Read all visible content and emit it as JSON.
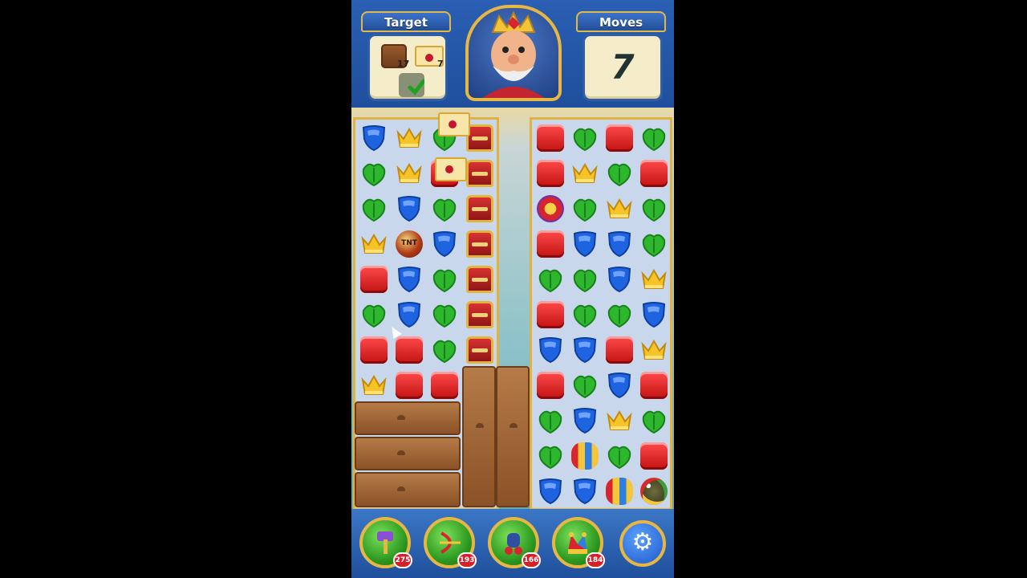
{
  "hud": {
    "target_label": "Target",
    "moves_label": "Moves",
    "moves_value": "7",
    "goals": [
      {
        "name": "crate",
        "count": "17"
      },
      {
        "name": "mail",
        "count": "7"
      },
      {
        "name": "tile",
        "count": "",
        "done": true
      }
    ]
  },
  "board_left": [
    [
      "shield",
      "crown",
      "leaf",
      "chest"
    ],
    [
      "leaf",
      "crown",
      "box",
      "chest"
    ],
    [
      "leaf",
      "shield",
      "leaf",
      "chest"
    ],
    [
      "crown",
      "tnt",
      "shield",
      "chest"
    ],
    [
      "box",
      "shield",
      "leaf",
      "chest"
    ],
    [
      "leaf",
      "shield",
      "leaf",
      "chest"
    ],
    [
      "box",
      "box",
      "leaf",
      "chest"
    ],
    [
      "crown",
      "box",
      "box",
      ""
    ]
  ],
  "board_right": [
    [
      "box",
      "leaf",
      "box",
      "leaf"
    ],
    [
      "box",
      "crown",
      "leaf",
      "box"
    ],
    [
      "propeller",
      "leaf",
      "crown",
      "leaf"
    ],
    [
      "box",
      "shield",
      "shield",
      "leaf"
    ],
    [
      "leaf",
      "leaf",
      "shield",
      "crown"
    ],
    [
      "box",
      "leaf",
      "leaf",
      "shield"
    ],
    [
      "shield",
      "shield",
      "box",
      "crown"
    ],
    [
      "box",
      "leaf",
      "shield",
      "box"
    ],
    [
      "leaf",
      "shield",
      "crown",
      "leaf"
    ],
    [
      "leaf",
      "rocket",
      "leaf",
      "box"
    ],
    [
      "shield",
      "shield",
      "rocket",
      "discoball"
    ]
  ],
  "tnt_text": "TNT",
  "toolbar": {
    "tools": [
      {
        "name": "hammer",
        "count": "275"
      },
      {
        "name": "arrow",
        "count": "193"
      },
      {
        "name": "cannon",
        "count": "166"
      },
      {
        "name": "jester-hat",
        "count": "184"
      }
    ],
    "settings_icon": "gear-icon"
  }
}
